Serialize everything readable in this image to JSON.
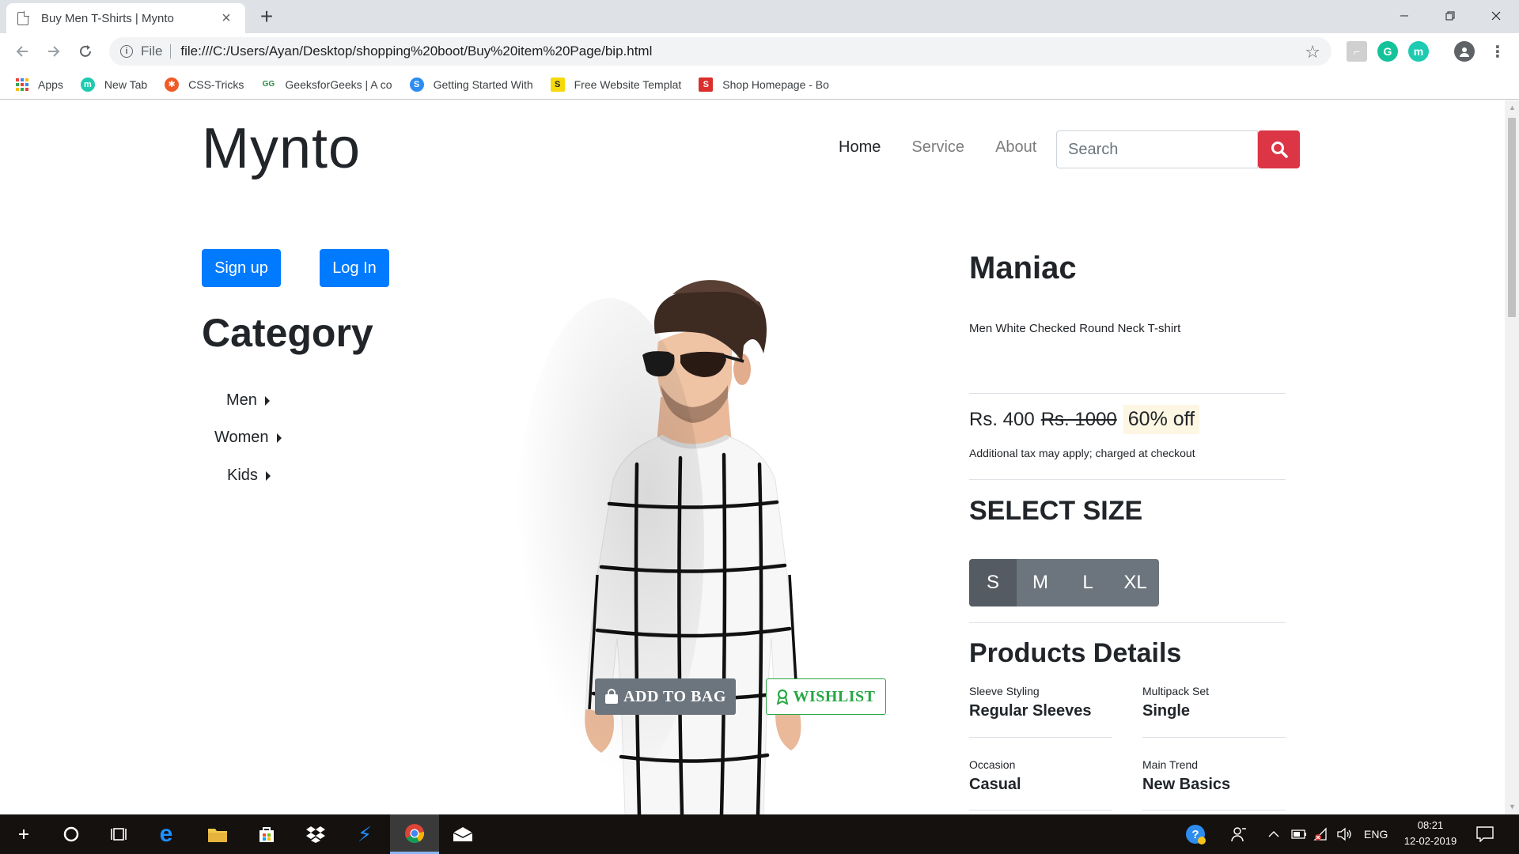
{
  "browser": {
    "tab_title": "Buy Men T-Shirts | Mynto",
    "new_tab_symbol": "+",
    "scheme": "File",
    "url": "file:///C:/Users/Ayan/Desktop/shopping%20boot/Buy%20item%20Page/bip.html",
    "bookmarks": [
      {
        "label": "Apps",
        "icon": "apps-grid-icon"
      },
      {
        "label": "New Tab",
        "icon": "m-icon",
        "color": "#1ecbb0"
      },
      {
        "label": "CSS-Tricks",
        "icon": "css-tricks-icon",
        "color": "#f05a28"
      },
      {
        "label": "GeeksforGeeks | A co",
        "icon": "gfg-icon",
        "color": "#2f8d46"
      },
      {
        "label": "Getting Started With",
        "icon": "s-icon",
        "color": "#2d8cf0"
      },
      {
        "label": "Free Website Templat",
        "icon": "s-yellow-icon",
        "color": "#f5d90a"
      },
      {
        "label": "Shop Homepage - Bo",
        "icon": "s-red-icon",
        "color": "#d9302e"
      }
    ]
  },
  "site": {
    "brand": "Mynto",
    "nav": [
      "Home",
      "Service",
      "About"
    ],
    "search_placeholder": "Search",
    "signup": "Sign up",
    "login": "Log In",
    "category_heading": "Category",
    "categories": [
      "Men",
      "Women",
      "Kids"
    ]
  },
  "product": {
    "name": "Maniac",
    "subtitle": "Men White Checked Round Neck T-shirt",
    "price": "Rs. 400",
    "old_price": "Rs. 1000",
    "discount": "60% off",
    "tax_note": "Additional tax may apply; charged at checkout",
    "size_heading": "SELECT SIZE",
    "sizes": [
      "S",
      "M",
      "L",
      "XL"
    ],
    "selected_size": "S",
    "details_heading": "Products Details",
    "details": [
      {
        "label": "Sleeve Styling",
        "value": "Regular Sleeves"
      },
      {
        "label": "Multipack Set",
        "value": "Single"
      },
      {
        "label": "Occasion",
        "value": "Casual"
      },
      {
        "label": "Main Trend",
        "value": "New Basics"
      }
    ],
    "add_to_bag": "ADD TO BAG",
    "wishlist": "WISHLIST"
  },
  "taskbar": {
    "language": "ENG",
    "time": "08:21",
    "date": "12-02-2019"
  }
}
